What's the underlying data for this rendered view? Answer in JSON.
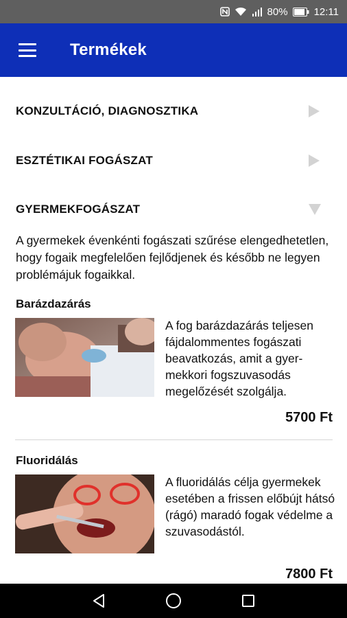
{
  "status_bar": {
    "nfc_icon": "nfc-icon",
    "wifi_icon": "wifi-icon",
    "signal_icon": "signal-icon",
    "battery_percent": "80%",
    "battery_icon": "battery-icon",
    "time": "12:11"
  },
  "app_bar": {
    "title": "Termékek",
    "menu_icon": "hamburger-menu-icon"
  },
  "categories": [
    {
      "label": "KONZULTÁCIÓ, DIAGNOSZTIKA",
      "expanded": false
    },
    {
      "label": "ESZTÉTIKAI FOGÁSZAT",
      "expanded": false
    },
    {
      "label": "GYERMEKFOGÁSZAT",
      "expanded": true
    }
  ],
  "category_description": "A gyermekek évenkénti fogászati szűrése elengedhetetlen, hogy fogaik megfelelően fejlődjenek és később ne legyen problémájuk fogaikkal.",
  "products": [
    {
      "title": "Barázdazárás",
      "description": "A fog barázdazárás teljesen fájdalommentes fogászati beavatkozás, amit a gyer-mekkori fogszuvasodás megelőzését szolgálja.",
      "price": "5700 Ft"
    },
    {
      "title": "Fluoridálás",
      "description": "A fluoridálás célja gyermekek esetében a frissen előbújt hátsó (rágó) maradó fogak védelme a szuvasodástól.",
      "price": "7800 Ft"
    }
  ],
  "nav_bar": {
    "back_icon": "back-triangle-icon",
    "home_icon": "home-circle-icon",
    "recents_icon": "recents-square-icon"
  },
  "colors": {
    "app_bar": "#0e2fb7",
    "status_bar": "#5f5f5f",
    "arrow": "#d3d3d3"
  }
}
